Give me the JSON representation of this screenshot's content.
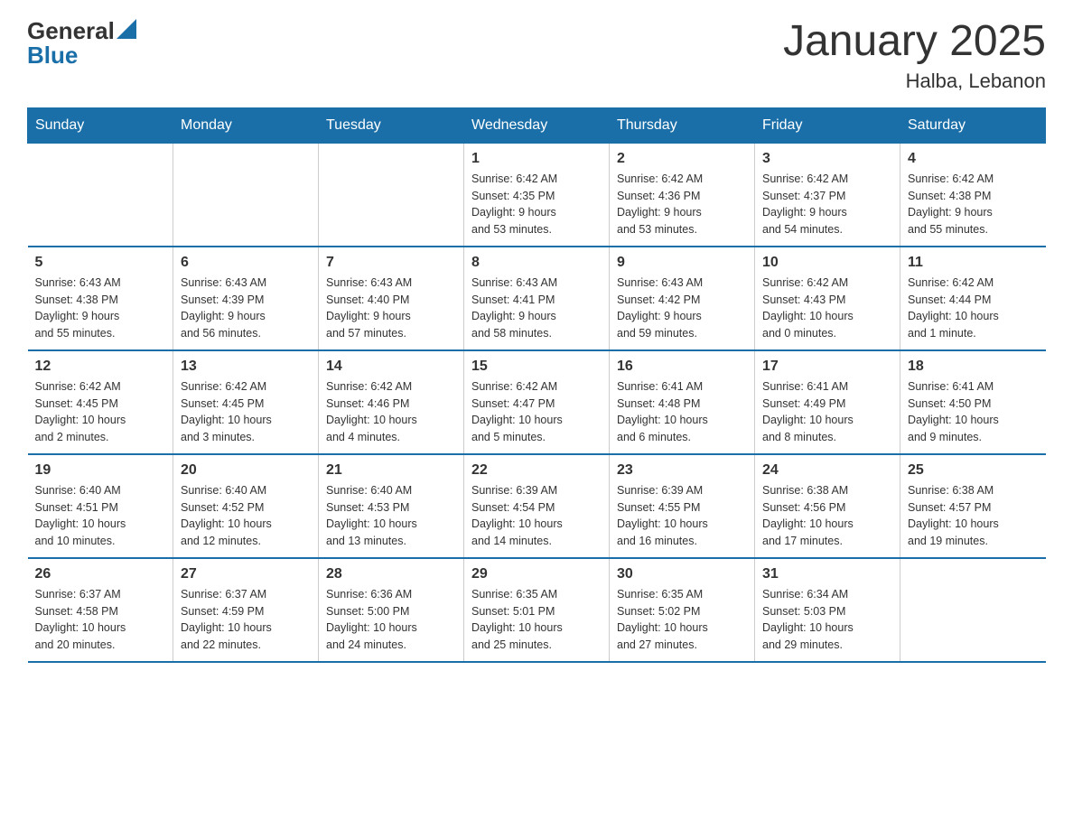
{
  "logo": {
    "general": "General",
    "blue": "Blue"
  },
  "title": "January 2025",
  "location": "Halba, Lebanon",
  "days_of_week": [
    "Sunday",
    "Monday",
    "Tuesday",
    "Wednesday",
    "Thursday",
    "Friday",
    "Saturday"
  ],
  "weeks": [
    [
      {
        "day": "",
        "info": ""
      },
      {
        "day": "",
        "info": ""
      },
      {
        "day": "",
        "info": ""
      },
      {
        "day": "1",
        "info": "Sunrise: 6:42 AM\nSunset: 4:35 PM\nDaylight: 9 hours\nand 53 minutes."
      },
      {
        "day": "2",
        "info": "Sunrise: 6:42 AM\nSunset: 4:36 PM\nDaylight: 9 hours\nand 53 minutes."
      },
      {
        "day": "3",
        "info": "Sunrise: 6:42 AM\nSunset: 4:37 PM\nDaylight: 9 hours\nand 54 minutes."
      },
      {
        "day": "4",
        "info": "Sunrise: 6:42 AM\nSunset: 4:38 PM\nDaylight: 9 hours\nand 55 minutes."
      }
    ],
    [
      {
        "day": "5",
        "info": "Sunrise: 6:43 AM\nSunset: 4:38 PM\nDaylight: 9 hours\nand 55 minutes."
      },
      {
        "day": "6",
        "info": "Sunrise: 6:43 AM\nSunset: 4:39 PM\nDaylight: 9 hours\nand 56 minutes."
      },
      {
        "day": "7",
        "info": "Sunrise: 6:43 AM\nSunset: 4:40 PM\nDaylight: 9 hours\nand 57 minutes."
      },
      {
        "day": "8",
        "info": "Sunrise: 6:43 AM\nSunset: 4:41 PM\nDaylight: 9 hours\nand 58 minutes."
      },
      {
        "day": "9",
        "info": "Sunrise: 6:43 AM\nSunset: 4:42 PM\nDaylight: 9 hours\nand 59 minutes."
      },
      {
        "day": "10",
        "info": "Sunrise: 6:42 AM\nSunset: 4:43 PM\nDaylight: 10 hours\nand 0 minutes."
      },
      {
        "day": "11",
        "info": "Sunrise: 6:42 AM\nSunset: 4:44 PM\nDaylight: 10 hours\nand 1 minute."
      }
    ],
    [
      {
        "day": "12",
        "info": "Sunrise: 6:42 AM\nSunset: 4:45 PM\nDaylight: 10 hours\nand 2 minutes."
      },
      {
        "day": "13",
        "info": "Sunrise: 6:42 AM\nSunset: 4:45 PM\nDaylight: 10 hours\nand 3 minutes."
      },
      {
        "day": "14",
        "info": "Sunrise: 6:42 AM\nSunset: 4:46 PM\nDaylight: 10 hours\nand 4 minutes."
      },
      {
        "day": "15",
        "info": "Sunrise: 6:42 AM\nSunset: 4:47 PM\nDaylight: 10 hours\nand 5 minutes."
      },
      {
        "day": "16",
        "info": "Sunrise: 6:41 AM\nSunset: 4:48 PM\nDaylight: 10 hours\nand 6 minutes."
      },
      {
        "day": "17",
        "info": "Sunrise: 6:41 AM\nSunset: 4:49 PM\nDaylight: 10 hours\nand 8 minutes."
      },
      {
        "day": "18",
        "info": "Sunrise: 6:41 AM\nSunset: 4:50 PM\nDaylight: 10 hours\nand 9 minutes."
      }
    ],
    [
      {
        "day": "19",
        "info": "Sunrise: 6:40 AM\nSunset: 4:51 PM\nDaylight: 10 hours\nand 10 minutes."
      },
      {
        "day": "20",
        "info": "Sunrise: 6:40 AM\nSunset: 4:52 PM\nDaylight: 10 hours\nand 12 minutes."
      },
      {
        "day": "21",
        "info": "Sunrise: 6:40 AM\nSunset: 4:53 PM\nDaylight: 10 hours\nand 13 minutes."
      },
      {
        "day": "22",
        "info": "Sunrise: 6:39 AM\nSunset: 4:54 PM\nDaylight: 10 hours\nand 14 minutes."
      },
      {
        "day": "23",
        "info": "Sunrise: 6:39 AM\nSunset: 4:55 PM\nDaylight: 10 hours\nand 16 minutes."
      },
      {
        "day": "24",
        "info": "Sunrise: 6:38 AM\nSunset: 4:56 PM\nDaylight: 10 hours\nand 17 minutes."
      },
      {
        "day": "25",
        "info": "Sunrise: 6:38 AM\nSunset: 4:57 PM\nDaylight: 10 hours\nand 19 minutes."
      }
    ],
    [
      {
        "day": "26",
        "info": "Sunrise: 6:37 AM\nSunset: 4:58 PM\nDaylight: 10 hours\nand 20 minutes."
      },
      {
        "day": "27",
        "info": "Sunrise: 6:37 AM\nSunset: 4:59 PM\nDaylight: 10 hours\nand 22 minutes."
      },
      {
        "day": "28",
        "info": "Sunrise: 6:36 AM\nSunset: 5:00 PM\nDaylight: 10 hours\nand 24 minutes."
      },
      {
        "day": "29",
        "info": "Sunrise: 6:35 AM\nSunset: 5:01 PM\nDaylight: 10 hours\nand 25 minutes."
      },
      {
        "day": "30",
        "info": "Sunrise: 6:35 AM\nSunset: 5:02 PM\nDaylight: 10 hours\nand 27 minutes."
      },
      {
        "day": "31",
        "info": "Sunrise: 6:34 AM\nSunset: 5:03 PM\nDaylight: 10 hours\nand 29 minutes."
      },
      {
        "day": "",
        "info": ""
      }
    ]
  ]
}
